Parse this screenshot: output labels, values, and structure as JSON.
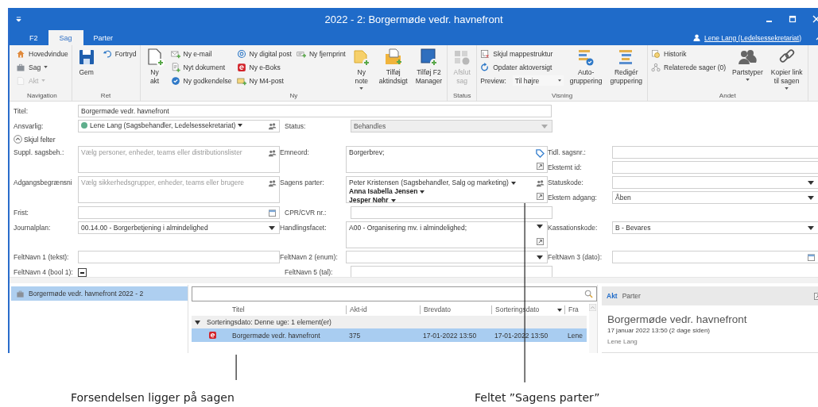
{
  "window": {
    "title": "2022 - 2: Borgermøde vedr. havnefront"
  },
  "tabs": [
    {
      "label": "F2",
      "selected": false
    },
    {
      "label": "Sag",
      "selected": true
    },
    {
      "label": "Parter",
      "selected": false
    }
  ],
  "user": {
    "name": "Lene Lang (Ledelsessekretariat)"
  },
  "ribbon": [
    {
      "label": "Navigation",
      "columns": [
        {
          "kind": "stack",
          "items": [
            {
              "kind": "button",
              "label": "Hovedvindue",
              "dropdown": false,
              "disabled": false
            },
            {
              "kind": "button",
              "label": "Sag",
              "dropdown": true,
              "disabled": false
            },
            {
              "kind": "button",
              "label": "Akt",
              "dropdown": true,
              "disabled": true
            }
          ]
        }
      ]
    },
    {
      "label": "Ret",
      "columns": [
        {
          "kind": "large",
          "lines": [
            "Gem"
          ],
          "dropdown": false,
          "disabled": false
        },
        {
          "kind": "stack",
          "items": [
            {
              "kind": "button",
              "label": "Fortryd",
              "dropdown": false,
              "disabled": false
            }
          ]
        }
      ]
    },
    {
      "label": "Ny",
      "columns": [
        {
          "kind": "large",
          "lines": [
            "Ny",
            "akt"
          ],
          "dropdown": false,
          "disabled": false
        },
        {
          "kind": "stack",
          "items": [
            {
              "kind": "button",
              "label": "Ny e-mail",
              "dropdown": false,
              "disabled": false
            },
            {
              "kind": "button",
              "label": "Nyt dokument",
              "dropdown": false,
              "disabled": false
            },
            {
              "kind": "button",
              "label": "Ny godkendelse",
              "dropdown": false,
              "disabled": false
            }
          ]
        },
        {
          "kind": "stack",
          "items": [
            {
              "kind": "button",
              "label": "Ny digital post",
              "dropdown": false,
              "disabled": false
            },
            {
              "kind": "button",
              "label": "Ny e-Boks",
              "dropdown": false,
              "disabled": false
            },
            {
              "kind": "button",
              "label": "Ny M4-post",
              "dropdown": false,
              "disabled": false
            }
          ]
        },
        {
          "kind": "stack",
          "items": [
            {
              "kind": "button",
              "label": "Ny fjernprint",
              "dropdown": false,
              "disabled": false
            }
          ]
        },
        {
          "kind": "large",
          "lines": [
            "Ny",
            "note"
          ],
          "dropdown": true,
          "disabled": false
        },
        {
          "kind": "large",
          "lines": [
            "Tilføj",
            "aktindsigt"
          ],
          "dropdown": false,
          "disabled": false
        },
        {
          "kind": "large",
          "lines": [
            "Tilføj F2",
            "Manager"
          ],
          "dropdown": false,
          "disabled": false
        }
      ]
    },
    {
      "label": "Status",
      "columns": [
        {
          "kind": "large",
          "lines": [
            "Afslut",
            "sag"
          ],
          "dropdown": false,
          "disabled": true
        }
      ]
    },
    {
      "label": "Visning",
      "columns": [
        {
          "kind": "stack",
          "items": [
            {
              "kind": "button",
              "label": "Skjul mappestruktur",
              "dropdown": false,
              "disabled": false
            },
            {
              "kind": "button",
              "label": "Opdater aktoversigt",
              "dropdown": false,
              "disabled": false
            },
            {
              "kind": "select",
              "label": "Preview:",
              "value": "Til højre"
            }
          ]
        },
        {
          "kind": "large",
          "lines": [
            "Auto-",
            "gruppering"
          ],
          "dropdown": false,
          "disabled": false
        },
        {
          "kind": "large",
          "lines": [
            "Redigér",
            "gruppering"
          ],
          "dropdown": false,
          "disabled": false
        }
      ]
    },
    {
      "label": "Andet",
      "columns": [
        {
          "kind": "stack",
          "items": [
            {
              "kind": "button",
              "label": "Historik",
              "dropdown": false,
              "disabled": false
            },
            {
              "kind": "button",
              "label": "Relaterede sager (0)",
              "dropdown": false,
              "disabled": false
            }
          ]
        },
        {
          "kind": "large",
          "lines": [
            "Partstyper"
          ],
          "dropdown": true,
          "disabled": false
        },
        {
          "kind": "large",
          "lines": [
            "Kopier link",
            "til sagen"
          ],
          "dropdown": true,
          "disabled": false
        }
      ]
    }
  ],
  "form": {
    "rows": [
      {
        "left": [
          {
            "label": "Titel:",
            "kind": "text",
            "value": "Borgermøde vedr. havnefront",
            "wide": true
          }
        ]
      },
      {
        "left": [
          {
            "label": "Ansvarlig:",
            "kind": "person",
            "value": "Lene Lang (Sagsbehandler, Ledelsessekretariat)",
            "color": "#5fae8c"
          }
        ],
        "middle": [
          {
            "label": "Status:",
            "kind": "select",
            "value": "Behandles",
            "disabled": true
          }
        ]
      },
      {
        "toggle": {
          "label": "Skjul felter",
          "expanded": true
        }
      },
      {
        "left": [
          {
            "label": "Suppl. sagsbeh.:",
            "kind": "picker",
            "placeholder": "Vælg personer, enheder, teams eller distributionslister"
          }
        ],
        "middle": [
          {
            "label": "Emneord:",
            "kind": "tags",
            "value": "Borgerbrev;"
          }
        ],
        "right": [
          {
            "label": "Tidl. sagsnr.:",
            "kind": "text"
          },
          {
            "label": "Eksternt id:",
            "kind": "text"
          }
        ]
      },
      {
        "left": [
          {
            "label": "Adgangsbegrænsni",
            "kind": "picker",
            "placeholder": "Vælg sikkerhedsgrupper, enheder, teams eller brugere"
          }
        ],
        "middle": [
          {
            "label": "Sagens parter:",
            "kind": "parties",
            "parties": [
              {
                "name": "Peter Kristensen (Sagsbehandler, Salg og marketing)",
                "emphasized": false
              },
              {
                "name": "Anna Isabella Jensen",
                "emphasized": true
              },
              {
                "name": "Jesper Nøhr",
                "emphasized": true
              }
            ]
          }
        ],
        "right": [
          {
            "label": "Statuskode:",
            "kind": "select",
            "disabled": false
          },
          {
            "label": "Ekstern adgang:",
            "kind": "select",
            "value": "Åben",
            "disabled": false
          }
        ]
      },
      {
        "left": [
          {
            "label": "Frist:",
            "kind": "date"
          }
        ],
        "middle": [
          {
            "label": "CPR/CVR nr.:",
            "kind": "text"
          }
        ]
      },
      {
        "left": [
          {
            "label": "Journalplan:",
            "kind": "select",
            "value": "00.14.00 - Borgerbetjening i almindelighed",
            "disabled": false
          }
        ],
        "middle": [
          {
            "label": "Handlingsfacet:",
            "kind": "multiselect",
            "value": "A00 - Organisering mv. i almindelighed;"
          }
        ],
        "right": [
          {
            "label": "Kassationskode:",
            "kind": "select",
            "value": "B - Bevares",
            "disabled": false
          }
        ]
      },
      {
        "left": [
          {
            "label": "FeltNavn 1 (tekst):",
            "kind": "text"
          }
        ],
        "middle": [
          {
            "label": "FeltNavn 2 (enum):",
            "kind": "select",
            "disabled": false
          }
        ],
        "right": [
          {
            "label": "FeltNavn 3 (dato):",
            "kind": "date"
          }
        ]
      },
      {
        "left": [
          {
            "label": "FeltNavn 4 (bool 1):",
            "kind": "checkbox",
            "indeterminate": true
          }
        ],
        "middle": [
          {
            "label": "FeltNavn 5 (tal):",
            "kind": "text"
          }
        ]
      }
    ]
  },
  "tree": [
    {
      "label": "Borgermøde vedr. havnefront 2022 - 2",
      "selected": true
    }
  ],
  "documents": {
    "columns": [
      {
        "label": "Titel",
        "sorted": false
      },
      {
        "label": "Akt-id",
        "sorted": false
      },
      {
        "label": "Brevdato",
        "sorted": false
      },
      {
        "label": "Sorteringsdato",
        "sorted": true
      },
      {
        "label": "Fra",
        "sorted": false
      }
    ],
    "groups": [
      {
        "label": "Sorteringsdato: Denne uge: 1 element(er)",
        "expanded": true,
        "rows": [
          {
            "selected": true,
            "cells": [
              "Borgermøde vedr. havnefront",
              "375",
              "17-01-2022 13:50",
              "17-01-2022 13:50",
              "Lene"
            ]
          }
        ]
      }
    ]
  },
  "preview": {
    "tabs": [
      {
        "label": "Akt",
        "selected": true
      },
      {
        "label": "Parter",
        "selected": false
      }
    ],
    "title": "Borgermøde vedr. havnefront",
    "date": "17 januar 2022 13:50 (2 dage siden)",
    "author": "Lene Lang"
  },
  "annotations": [
    {
      "text": "Forsendelsen ligger på sagen"
    },
    {
      "text": "Feltet ”Sagens parter”"
    }
  ]
}
